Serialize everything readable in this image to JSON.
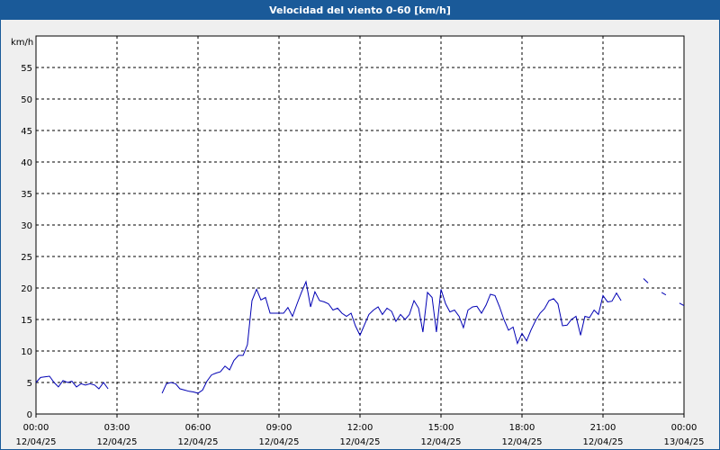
{
  "window": {
    "title": "Velocidad del viento 0-60 [km/h]"
  },
  "chart_data": {
    "type": "line",
    "title": "Velocidad del viento 0-60 [km/h]",
    "ylabel": "km/h",
    "ylim": [
      0,
      60
    ],
    "yticks": [
      0,
      5,
      10,
      15,
      20,
      25,
      30,
      35,
      40,
      45,
      50,
      55
    ],
    "xlim_hours": [
      0,
      24
    ],
    "xticks": [
      {
        "hour": 0,
        "time": "00:00",
        "date": "12/04/25"
      },
      {
        "hour": 3,
        "time": "03:00",
        "date": "12/04/25"
      },
      {
        "hour": 6,
        "time": "06:00",
        "date": "12/04/25"
      },
      {
        "hour": 9,
        "time": "09:00",
        "date": "12/04/25"
      },
      {
        "hour": 12,
        "time": "12:00",
        "date": "12/04/25"
      },
      {
        "hour": 15,
        "time": "15:00",
        "date": "12/04/25"
      },
      {
        "hour": 18,
        "time": "18:00",
        "date": "12/04/25"
      },
      {
        "hour": 21,
        "time": "21:00",
        "date": "12/04/25"
      },
      {
        "hour": 24,
        "time": "00:00",
        "date": "13/04/25"
      }
    ],
    "grid": true,
    "line_color": "#0000b4",
    "series": [
      {
        "segments": [
          [
            [
              0.0,
              5.0
            ],
            [
              0.17,
              5.8
            ],
            [
              0.5,
              6.0
            ],
            [
              0.67,
              5.0
            ],
            [
              0.83,
              4.3
            ],
            [
              1.0,
              5.3
            ],
            [
              1.17,
              5.0
            ],
            [
              1.33,
              5.2
            ],
            [
              1.5,
              4.3
            ],
            [
              1.67,
              4.8
            ],
            [
              1.83,
              4.6
            ],
            [
              2.0,
              4.8
            ],
            [
              2.17,
              4.6
            ],
            [
              2.33,
              4.0
            ],
            [
              2.5,
              5.0
            ],
            [
              2.67,
              4.0
            ]
          ],
          [
            [
              4.67,
              3.3
            ],
            [
              4.83,
              4.8
            ],
            [
              5.0,
              5.0
            ],
            [
              5.17,
              4.8
            ],
            [
              5.33,
              4.0
            ],
            [
              5.5,
              3.8
            ],
            [
              5.67,
              3.6
            ],
            [
              5.83,
              3.5
            ],
            [
              6.0,
              3.3
            ],
            [
              6.17,
              3.8
            ],
            [
              6.33,
              5.2
            ],
            [
              6.5,
              6.2
            ],
            [
              6.67,
              6.5
            ],
            [
              6.83,
              6.7
            ],
            [
              7.0,
              7.6
            ],
            [
              7.17,
              7.0
            ],
            [
              7.33,
              8.5
            ],
            [
              7.5,
              9.3
            ],
            [
              7.67,
              9.3
            ],
            [
              7.83,
              11.0
            ],
            [
              8.0,
              18.0
            ],
            [
              8.17,
              19.8
            ],
            [
              8.33,
              18.1
            ],
            [
              8.5,
              18.5
            ],
            [
              8.67,
              16.0
            ],
            [
              8.83,
              16.0
            ],
            [
              9.0,
              16.0
            ],
            [
              9.17,
              16.0
            ],
            [
              9.33,
              16.9
            ],
            [
              9.5,
              15.5
            ],
            [
              9.67,
              17.5
            ],
            [
              9.83,
              19.3
            ],
            [
              10.0,
              21.0
            ],
            [
              10.17,
              17.0
            ],
            [
              10.33,
              19.4
            ],
            [
              10.5,
              18.0
            ],
            [
              10.67,
              17.8
            ],
            [
              10.83,
              17.5
            ],
            [
              11.0,
              16.5
            ],
            [
              11.17,
              16.8
            ],
            [
              11.33,
              16.0
            ],
            [
              11.5,
              15.5
            ],
            [
              11.67,
              16.0
            ],
            [
              11.83,
              14.0
            ],
            [
              12.0,
              12.5
            ],
            [
              12.17,
              14.2
            ],
            [
              12.33,
              15.8
            ],
            [
              12.5,
              16.5
            ],
            [
              12.67,
              17.0
            ],
            [
              12.83,
              15.8
            ],
            [
              13.0,
              16.8
            ],
            [
              13.17,
              16.3
            ],
            [
              13.33,
              14.7
            ],
            [
              13.5,
              15.8
            ],
            [
              13.67,
              15.0
            ],
            [
              13.83,
              15.8
            ],
            [
              14.0,
              18.0
            ],
            [
              14.17,
              16.8
            ],
            [
              14.33,
              13.0
            ],
            [
              14.5,
              19.3
            ],
            [
              14.67,
              18.5
            ],
            [
              14.83,
              13.0
            ],
            [
              15.0,
              19.8
            ],
            [
              15.17,
              17.5
            ],
            [
              15.33,
              16.2
            ],
            [
              15.5,
              16.5
            ],
            [
              15.67,
              15.5
            ],
            [
              15.83,
              13.7
            ],
            [
              16.0,
              16.5
            ],
            [
              16.17,
              17.0
            ],
            [
              16.33,
              17.1
            ],
            [
              16.5,
              16.0
            ],
            [
              16.67,
              17.3
            ],
            [
              16.83,
              19.0
            ],
            [
              17.0,
              18.8
            ],
            [
              17.17,
              17.0
            ],
            [
              17.33,
              15.0
            ],
            [
              17.5,
              13.3
            ],
            [
              17.67,
              13.8
            ],
            [
              17.83,
              11.2
            ],
            [
              18.0,
              12.8
            ],
            [
              18.17,
              11.6
            ],
            [
              18.33,
              13.3
            ],
            [
              18.5,
              14.8
            ],
            [
              18.67,
              16.0
            ],
            [
              18.83,
              16.7
            ],
            [
              19.0,
              18.0
            ],
            [
              19.17,
              18.3
            ],
            [
              19.33,
              17.5
            ],
            [
              19.5,
              14.0
            ],
            [
              19.67,
              14.1
            ],
            [
              19.83,
              15.0
            ],
            [
              20.0,
              15.5
            ],
            [
              20.17,
              12.5
            ],
            [
              20.33,
              15.5
            ],
            [
              20.5,
              15.3
            ],
            [
              20.67,
              16.5
            ],
            [
              20.83,
              15.8
            ],
            [
              21.0,
              18.8
            ],
            [
              21.17,
              17.8
            ],
            [
              21.33,
              17.9
            ],
            [
              21.5,
              19.2
            ],
            [
              21.67,
              18.0
            ]
          ],
          [
            [
              22.5,
              21.5
            ],
            [
              22.67,
              20.8
            ]
          ],
          [
            [
              23.17,
              19.3
            ],
            [
              23.33,
              18.9
            ]
          ],
          [
            [
              23.83,
              17.6
            ],
            [
              24.0,
              17.2
            ]
          ]
        ]
      }
    ]
  }
}
